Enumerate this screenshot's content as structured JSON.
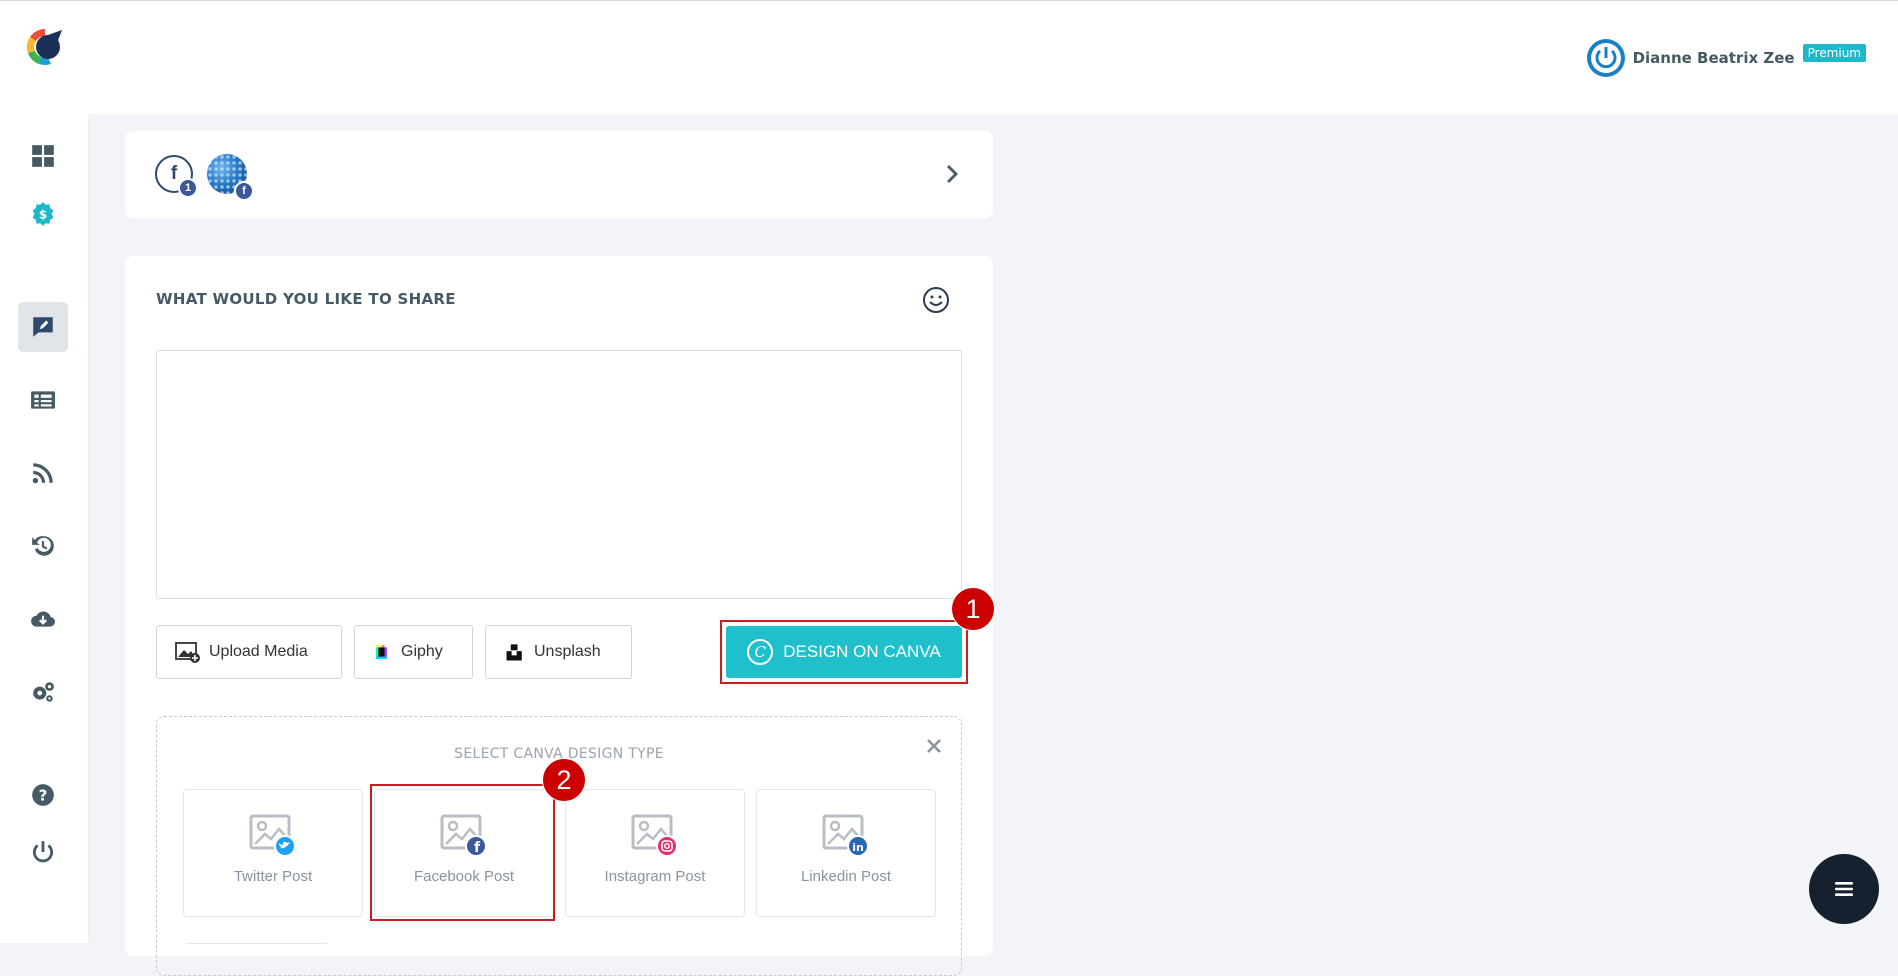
{
  "user": {
    "name": "Dianne Beatrix Zee",
    "plan_badge": "Premium"
  },
  "accounts": {
    "facebook_count": "1"
  },
  "compose": {
    "title": "WHAT WOULD YOU LIKE TO SHARE",
    "post_text": "",
    "upload_label": "Upload Media",
    "giphy_label": "Giphy",
    "unsplash_label": "Unsplash",
    "canva_label": "DESIGN ON CANVA"
  },
  "canva_types": {
    "title": "SELECT CANVA DESIGN TYPE",
    "items": [
      {
        "label": "Twitter Post",
        "badge_color": "#1da1f2"
      },
      {
        "label": "Facebook Post",
        "badge_color": "#3b5998"
      },
      {
        "label": "Instagram Post",
        "badge_color": "#e1306c"
      },
      {
        "label": "Linkedin Post",
        "badge_color": "#2867b2"
      }
    ]
  },
  "steps": {
    "one": "1",
    "two": "2"
  },
  "colors": {
    "accent": "#1fc0cc",
    "highlight": "#c51f1f",
    "sidebar_icon": "#455a64",
    "dark": "#15212f"
  }
}
